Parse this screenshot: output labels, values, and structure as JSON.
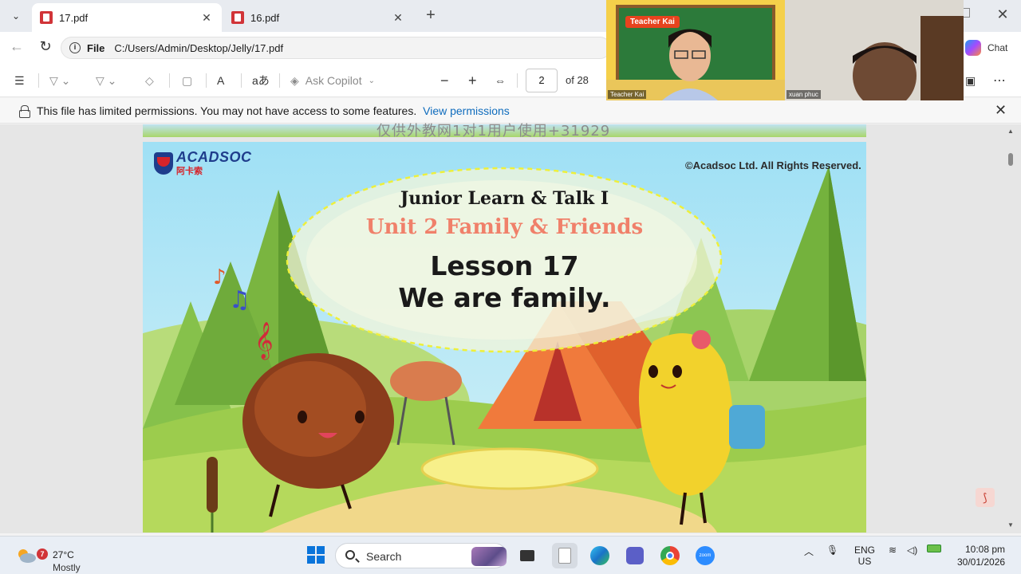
{
  "tabs": [
    {
      "label": "17.pdf",
      "active": true
    },
    {
      "label": "16.pdf",
      "active": false
    }
  ],
  "address": {
    "scheme": "File",
    "path": "C:/Users/Admin/Desktop/Jelly/17.pdf"
  },
  "chat_label": "Chat",
  "pdf_toolbar": {
    "copilot_label": "Ask Copilot",
    "page_current": "2",
    "page_total": "of 28"
  },
  "permission": {
    "message": "This file has limited permissions. You may not have access to some features.",
    "link": "View permissions"
  },
  "slide": {
    "watermark": "仅供外教网1对1用户使用+31929",
    "logo_brand": "ACADSOC",
    "logo_cn": "阿卡索",
    "copyright": "©Acadsoc Ltd. All Rights Reserved.",
    "series": "Junior Learn & Talk I",
    "unit": "Unit 2 Family & Friends",
    "lesson": "Lesson 17",
    "title": "We are family."
  },
  "video": {
    "teacher_tag": "Teacher Kai",
    "teacher_name": "Teacher Kai",
    "student_name": "xuan phuc"
  },
  "taskbar": {
    "weather_badge": "7",
    "weather_temp": "27°C",
    "weather_desc": "Mostly cloudy",
    "search_label": "Search",
    "lang_top": "ENG",
    "lang_bottom": "US",
    "clock_time": "10:08 pm",
    "clock_date": "30/01/2026"
  },
  "colors": {
    "accent_link": "#0f6cbd",
    "unit_title": "#f0806a",
    "taskbar_bg": "#e9eef5"
  }
}
